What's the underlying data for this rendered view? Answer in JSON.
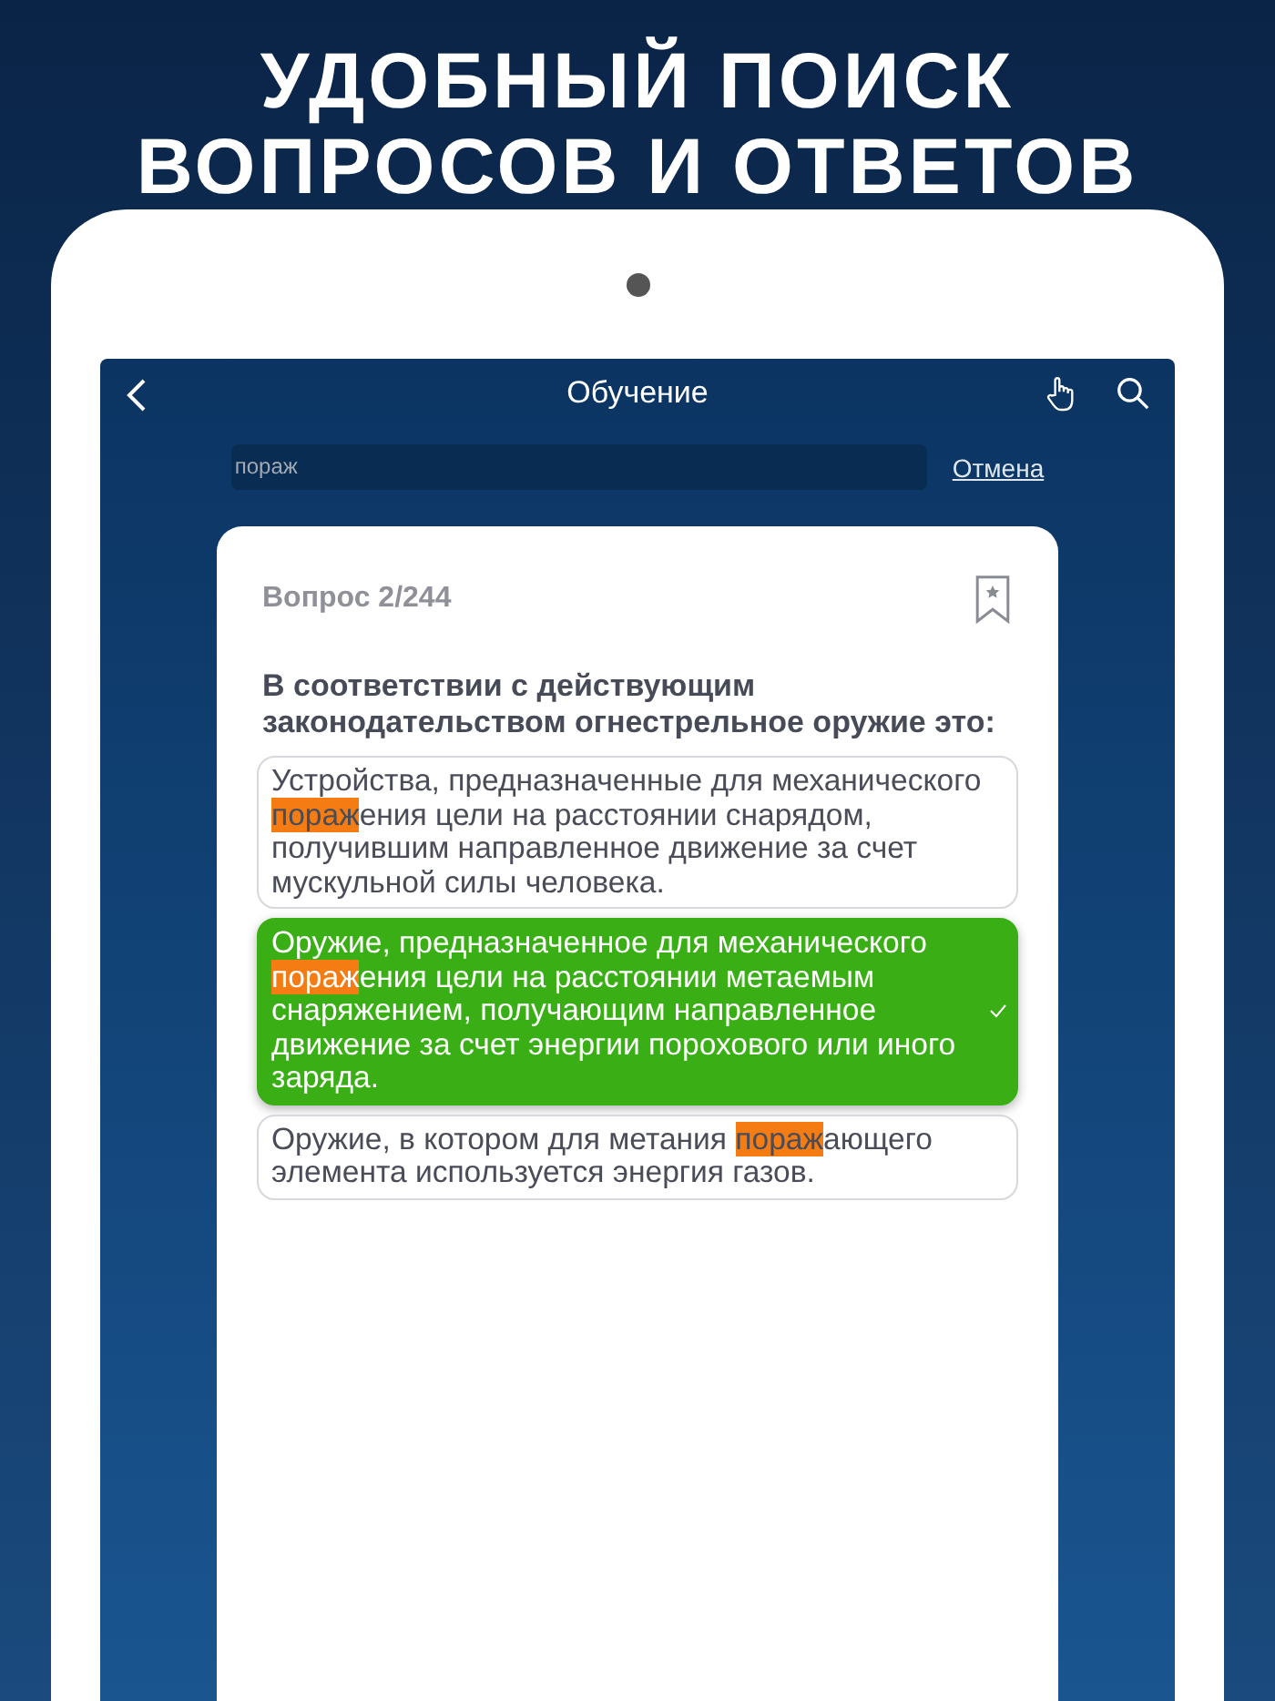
{
  "headline": [
    "УДОБНЫЙ ПОИСК",
    "ВОПРОСОВ И ОТВЕТОВ"
  ],
  "nav": {
    "title": "Обучение"
  },
  "search": {
    "value": "пораж",
    "cancel": "Отмена"
  },
  "question": {
    "counter": "Вопрос 2/244",
    "bookmarked": false,
    "text": "В соответствии с действующим законодательством огнестрельное оружие это:"
  },
  "answers": [
    {
      "selected": false,
      "segments": [
        {
          "text": "Устройства, предназначенные для механического ",
          "highlight": false
        },
        {
          "text": "пораж",
          "highlight": true
        },
        {
          "text": "ения цели на расстоянии снарядом, получившим направленное движение за счет мускульной силы человека.",
          "highlight": false
        }
      ]
    },
    {
      "selected": true,
      "segments": [
        {
          "text": "Оружие, предназначенное для механического ",
          "highlight": false
        },
        {
          "text": "пораж",
          "highlight": true
        },
        {
          "text": "ения цели на расстоянии метаемым снаряжением, получающим направленное движение за счет энергии порохового или иного заряда.",
          "highlight": false
        }
      ]
    },
    {
      "selected": false,
      "segments": [
        {
          "text": "Оружие, в котором для метания ",
          "highlight": false
        },
        {
          "text": "пораж",
          "highlight": true
        },
        {
          "text": "ающего элемента используется энергия газов.",
          "highlight": false
        }
      ]
    }
  ]
}
